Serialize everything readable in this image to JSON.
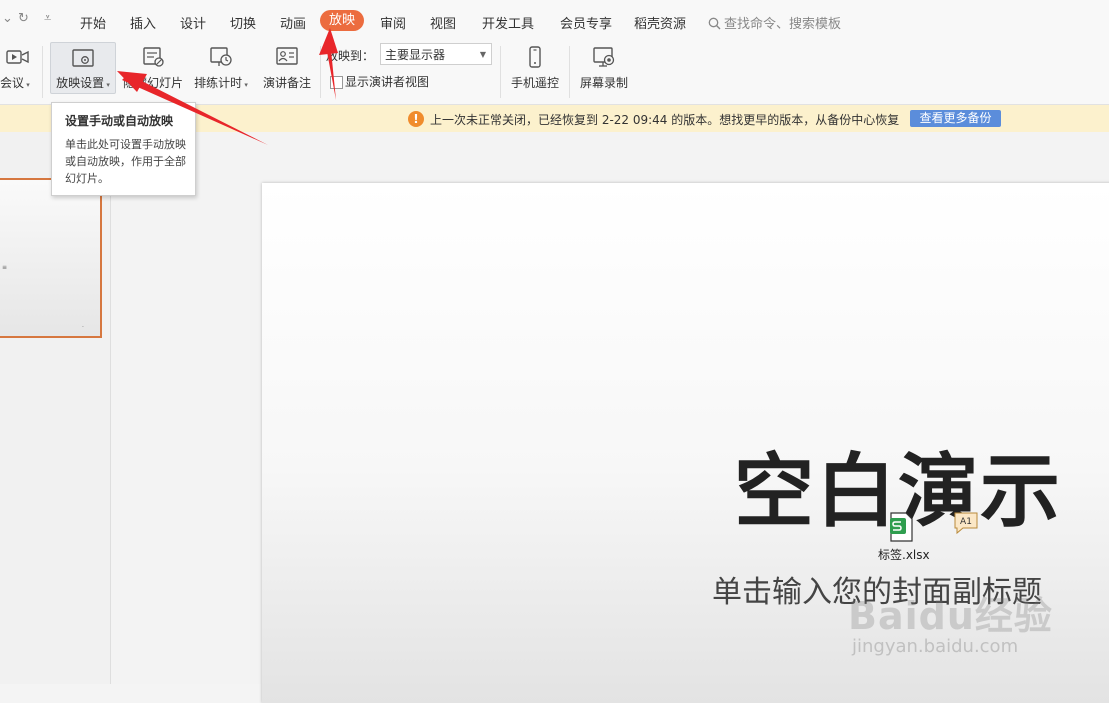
{
  "menu": {
    "items": [
      "开始",
      "插入",
      "设计",
      "切换",
      "动画",
      "放映",
      "审阅",
      "视图",
      "开发工具",
      "会员专享",
      "稻壳资源"
    ],
    "active": "放映",
    "search_placeholder": "查找命令、搜索模板"
  },
  "ribbon": {
    "meeting_label": "会议",
    "setup_label": "放映设置",
    "hide_label": "隐藏幻灯片",
    "rehearse_label": "排练计时",
    "notes_label": "演讲备注",
    "project_to_label": "放映到：",
    "project_to_value": "主要显示器",
    "presenter_view_label": "显示演讲者视图",
    "phone_remote_label": "手机遥控",
    "screen_record_label": "屏幕录制"
  },
  "notice": {
    "message": "上一次未正常关闭，已经恢复到 2-22 09:44 的版本。想找更早的版本，从备份中心恢复",
    "button": "查看更多备份",
    "icon": "warning-icon"
  },
  "tooltip": {
    "title": "设置手动或自动放映",
    "body": "单击此处可设置手动放映或自动放映，作用于全部幻灯片。"
  },
  "slide": {
    "title": "空白演示",
    "subtitle": "单击输入您的封面副标题"
  },
  "attachment": {
    "file_name": "标签.xlsx",
    "badge": "A1"
  },
  "watermark": {
    "text": "Baidu经验",
    "url": "jingyan.baidu.com"
  },
  "colors": {
    "accent": "#ec6c3f",
    "notice_bg": "#fcf1cd",
    "notice_button": "#5b8ddb",
    "arrow": "#e8262a"
  }
}
